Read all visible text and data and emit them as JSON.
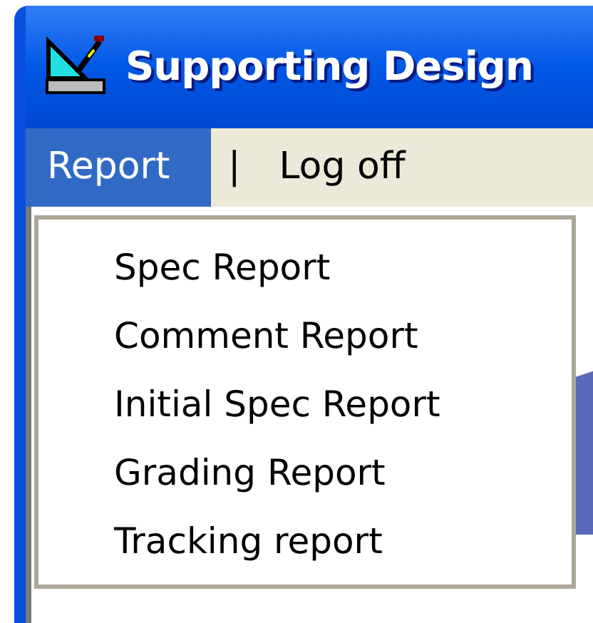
{
  "window": {
    "title": "Supporting Design"
  },
  "menu_bar": [
    {
      "label": "Report",
      "selected": true,
      "kind": "menu"
    },
    {
      "label": "|",
      "kind": "separator"
    },
    {
      "label": "Log off",
      "selected": false,
      "kind": "menu"
    }
  ],
  "dropdown": {
    "items": [
      {
        "label": "Spec Report"
      },
      {
        "label": "Comment Report"
      },
      {
        "label": "Initial Spec Report"
      },
      {
        "label": "Grading Report"
      },
      {
        "label": "Tracking report"
      }
    ]
  }
}
